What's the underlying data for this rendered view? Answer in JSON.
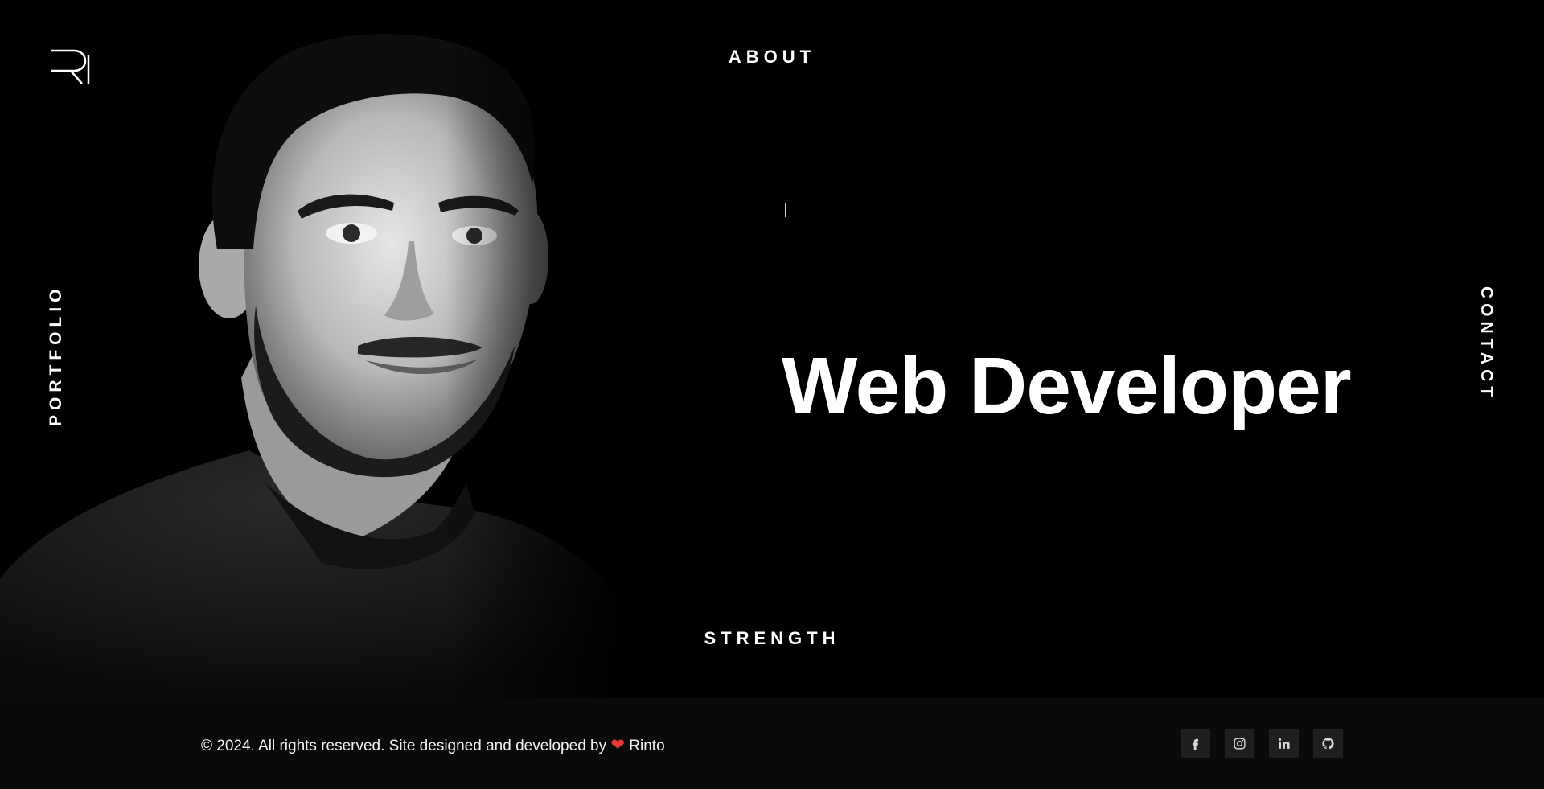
{
  "nav": {
    "about": "ABOUT",
    "portfolio": "PORTFOLIO",
    "contact": "CONTACT",
    "strength": "STRENGTH"
  },
  "hero": {
    "headline": "Web Developer",
    "logo_icon": "ri-monogram-logo",
    "portrait_image": "black-and-white-portrait-photo"
  },
  "footer": {
    "copyright": "© 2024. All rights reserved. Site designed and developed by",
    "heart": "❤",
    "author": "Rinto",
    "social_icons": [
      "facebook-icon",
      "instagram-icon",
      "linkedin-icon",
      "github-icon"
    ]
  },
  "colors": {
    "background": "#000000",
    "footer_background": "#0a0a0a",
    "text": "#ffffff",
    "heart": "#e53935",
    "social_button": "#1f1f1f"
  }
}
